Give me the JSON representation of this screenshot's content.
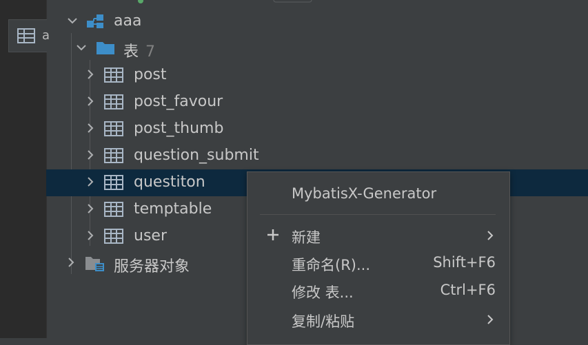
{
  "sidebar": {
    "tab_label": "a"
  },
  "tree": {
    "db_name": "aaa",
    "folder_name": "表",
    "folder_count": "7",
    "tables": [
      {
        "label": "post"
      },
      {
        "label": "post_favour"
      },
      {
        "label": "post_thumb"
      },
      {
        "label": "question_submit"
      },
      {
        "label": "questiton"
      },
      {
        "label": "temptable"
      },
      {
        "label": "user"
      }
    ],
    "server_objects": "服务器对象"
  },
  "context_menu": {
    "generator": "MybatisX-Generator",
    "new": "新建",
    "rename": "重命名(R)...",
    "rename_shortcut": "Shift+F6",
    "modify": "修改 表...",
    "modify_shortcut": "Ctrl+F6",
    "copy_paste": "复制/粘贴"
  },
  "colors": {
    "background": "#3c3f41",
    "selection": "#0d293e",
    "folder_icon": "#3d8ec9",
    "text": "#c8c8c8"
  }
}
